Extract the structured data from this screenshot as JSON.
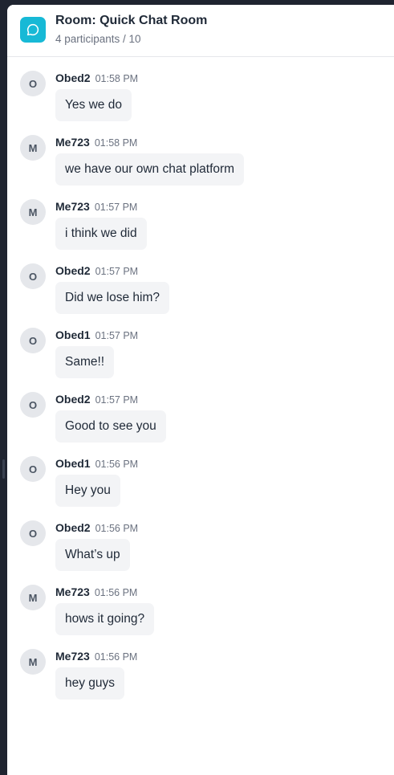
{
  "room": {
    "title": "Room: Quick Chat Room",
    "participants": "4 participants / 10",
    "icon": "chat-bubble-icon",
    "accent": "#17b9d6"
  },
  "messages": [
    {
      "initial": "O",
      "author": "Obed2",
      "time": "01:58 PM",
      "text": "Yes we do"
    },
    {
      "initial": "M",
      "author": "Me723",
      "time": "01:58 PM",
      "text": "we have our own chat platform"
    },
    {
      "initial": "M",
      "author": "Me723",
      "time": "01:57 PM",
      "text": "i think we did"
    },
    {
      "initial": "O",
      "author": "Obed2",
      "time": "01:57 PM",
      "text": "Did we lose him?"
    },
    {
      "initial": "O",
      "author": "Obed1",
      "time": "01:57 PM",
      "text": "Same!!"
    },
    {
      "initial": "O",
      "author": "Obed2",
      "time": "01:57 PM",
      "text": "Good to see you"
    },
    {
      "initial": "O",
      "author": "Obed1",
      "time": "01:56 PM",
      "text": "Hey you"
    },
    {
      "initial": "O",
      "author": "Obed2",
      "time": "01:56 PM",
      "text": "What’s up"
    },
    {
      "initial": "M",
      "author": "Me723",
      "time": "01:56 PM",
      "text": "hows it going?"
    },
    {
      "initial": "M",
      "author": "Me723",
      "time": "01:56 PM",
      "text": "hey guys"
    }
  ]
}
